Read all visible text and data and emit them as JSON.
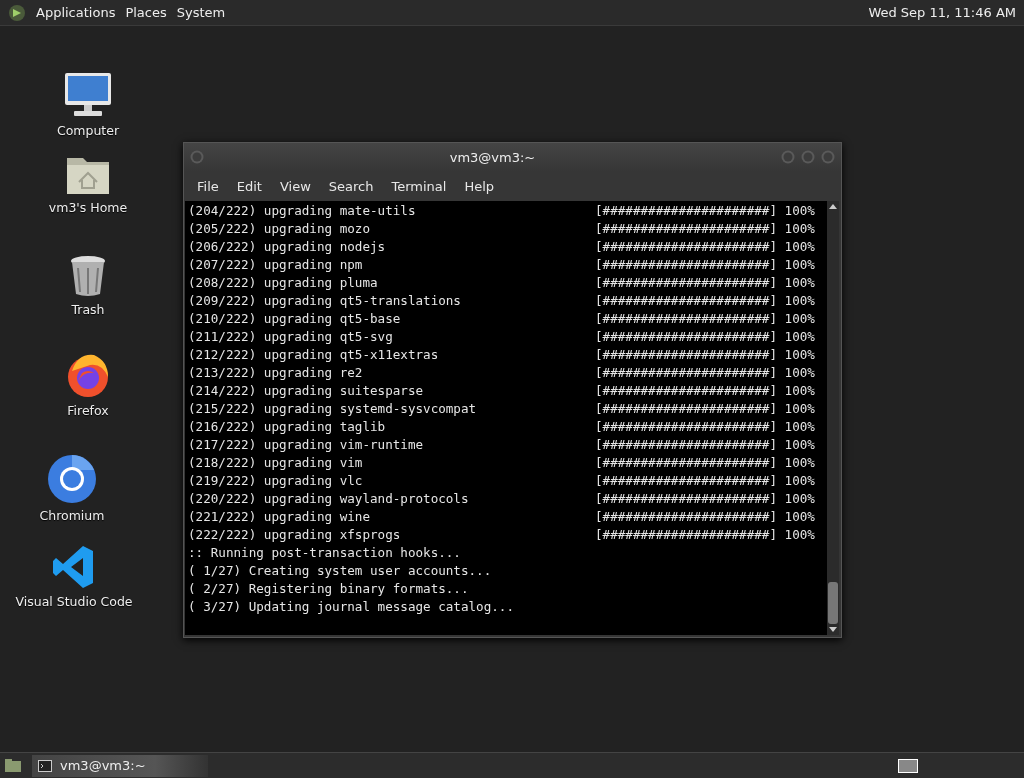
{
  "top_panel": {
    "menus": [
      "Applications",
      "Places",
      "System"
    ],
    "clock": "Wed Sep 11, 11:46 AM"
  },
  "desktop_icons": [
    {
      "kind": "computer",
      "label": "Computer"
    },
    {
      "kind": "home",
      "label": "vm3's Home"
    },
    {
      "kind": "trash",
      "label": "Trash"
    },
    {
      "kind": "firefox",
      "label": "Firefox"
    },
    {
      "kind": "chromium",
      "label": "Chromium"
    },
    {
      "kind": "vscode",
      "label": "Visual Studio Code"
    }
  ],
  "terminal": {
    "title": "vm3@vm3:~",
    "menu": [
      "File",
      "Edit",
      "View",
      "Search",
      "Terminal",
      "Help"
    ],
    "lines": [
      {
        "text": "(204/222) upgrading mate-utils",
        "progress": "[######################] 100%"
      },
      {
        "text": "(205/222) upgrading mozo",
        "progress": "[######################] 100%"
      },
      {
        "text": "(206/222) upgrading nodejs",
        "progress": "[######################] 100%"
      },
      {
        "text": "(207/222) upgrading npm",
        "progress": "[######################] 100%"
      },
      {
        "text": "(208/222) upgrading pluma",
        "progress": "[######################] 100%"
      },
      {
        "text": "(209/222) upgrading qt5-translations",
        "progress": "[######################] 100%"
      },
      {
        "text": "(210/222) upgrading qt5-base",
        "progress": "[######################] 100%"
      },
      {
        "text": "(211/222) upgrading qt5-svg",
        "progress": "[######################] 100%"
      },
      {
        "text": "(212/222) upgrading qt5-x11extras",
        "progress": "[######################] 100%"
      },
      {
        "text": "(213/222) upgrading re2",
        "progress": "[######################] 100%"
      },
      {
        "text": "(214/222) upgrading suitesparse",
        "progress": "[######################] 100%"
      },
      {
        "text": "(215/222) upgrading systemd-sysvcompat",
        "progress": "[######################] 100%"
      },
      {
        "text": "(216/222) upgrading taglib",
        "progress": "[######################] 100%"
      },
      {
        "text": "(217/222) upgrading vim-runtime",
        "progress": "[######################] 100%"
      },
      {
        "text": "(218/222) upgrading vim",
        "progress": "[######################] 100%"
      },
      {
        "text": "(219/222) upgrading vlc",
        "progress": "[######################] 100%"
      },
      {
        "text": "(220/222) upgrading wayland-protocols",
        "progress": "[######################] 100%"
      },
      {
        "text": "(221/222) upgrading wine",
        "progress": "[######################] 100%"
      },
      {
        "text": "(222/222) upgrading xfsprogs",
        "progress": "[######################] 100%"
      },
      {
        "text": ":: Running post-transaction hooks..."
      },
      {
        "text": "( 1/27) Creating system user accounts..."
      },
      {
        "text": "( 2/27) Registering binary formats..."
      },
      {
        "text": "( 3/27) Updating journal message catalog..."
      }
    ]
  },
  "taskbar": {
    "tasks": [
      {
        "label": "vm3@vm3:~",
        "selected": true
      }
    ]
  }
}
